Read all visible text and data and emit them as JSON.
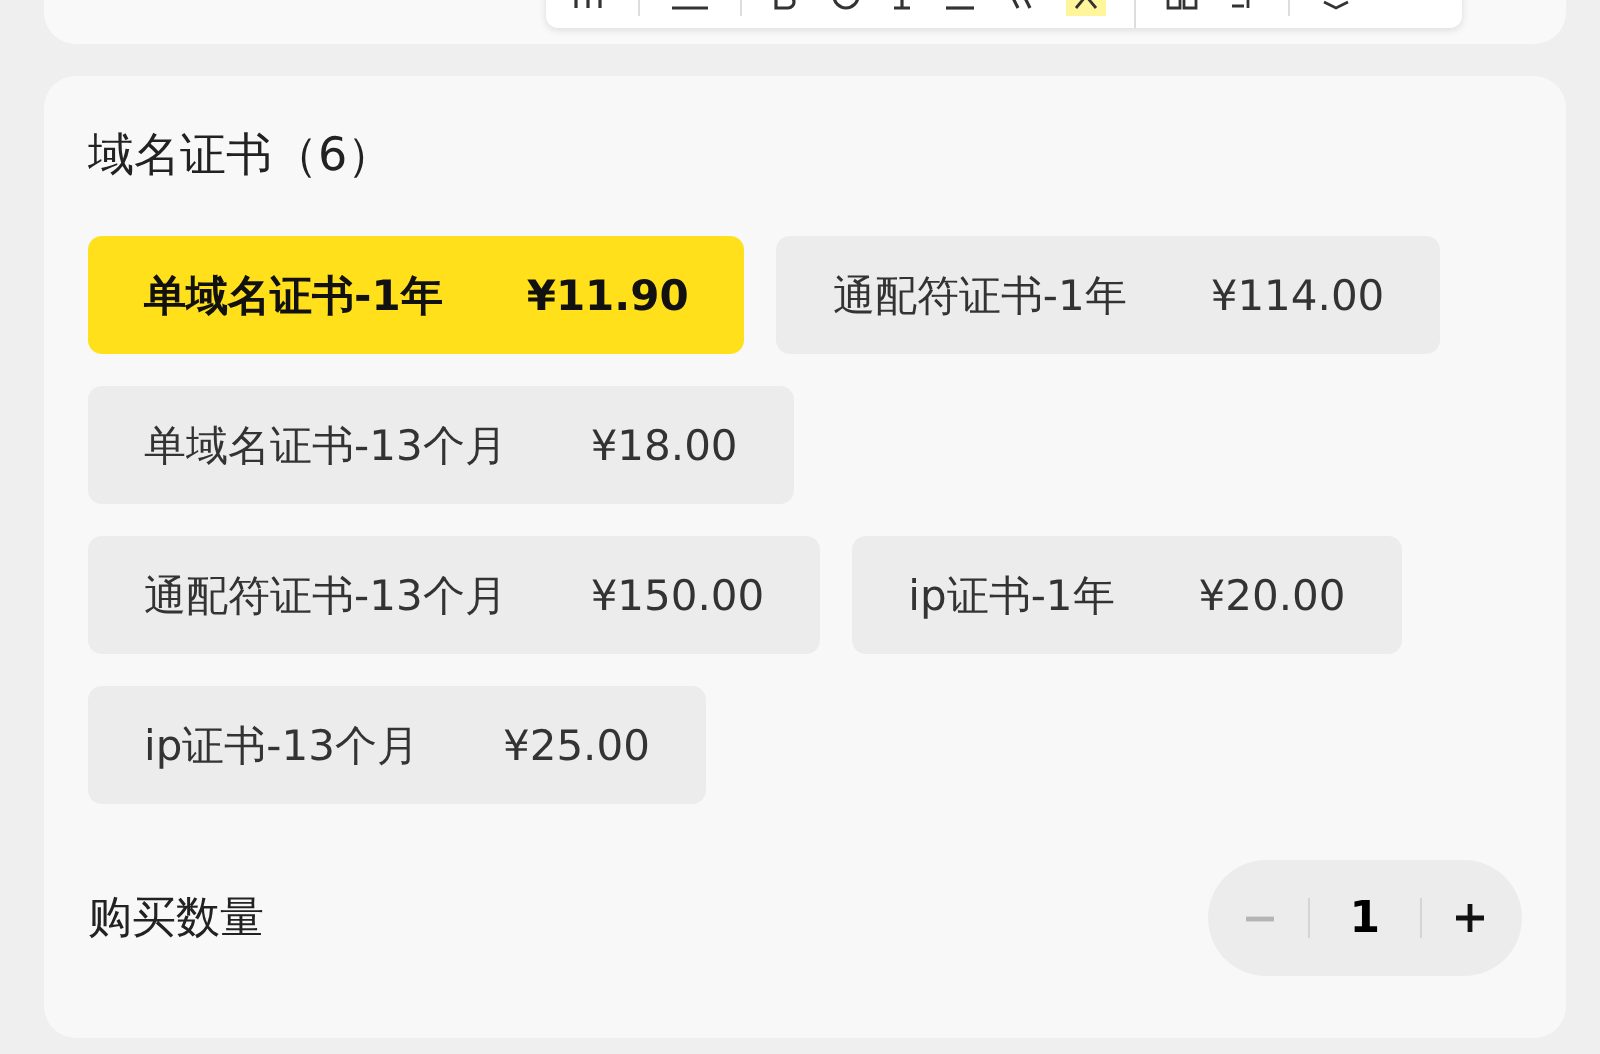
{
  "section": {
    "title": "域名证书（6）"
  },
  "options": [
    {
      "name": "单域名证书-1年",
      "price": "¥11.90",
      "selected": true
    },
    {
      "name": "通配符证书-1年",
      "price": "¥114.00",
      "selected": false
    },
    {
      "name": "单域名证书-13个月",
      "price": "¥18.00",
      "selected": false
    },
    {
      "name": "通配符证书-13个月",
      "price": "¥150.00",
      "selected": false
    },
    {
      "name": "ip证书-1年",
      "price": "¥20.00",
      "selected": false
    },
    {
      "name": "ip证书-13个月",
      "price": "¥25.00",
      "selected": false
    }
  ],
  "quantity": {
    "label": "购买数量",
    "value": "1",
    "minus_disabled": true
  }
}
